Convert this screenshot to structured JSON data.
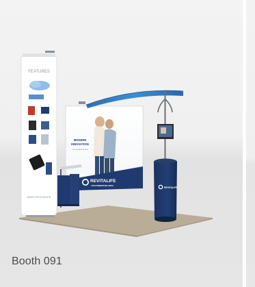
{
  "booth": {
    "caption": "Booth 091",
    "banner_heading": "FEATURES",
    "banner_footer": "WWW.REVITALIFE",
    "wall_headline_line1": "MODERN",
    "wall_headline_line2": "INNOVATION",
    "wall_tagline": "over a brand of true",
    "brand_name": "REVITALIFE",
    "brand_tagline": "YOUR PREMIUM WELLNESS",
    "counter_brand": "REVITALIFE"
  },
  "colors": {
    "navy": "#1f3a6e",
    "accent_blue": "#3b8fd0",
    "carpet": "#b9ad97",
    "background": "#f0f0f0"
  }
}
